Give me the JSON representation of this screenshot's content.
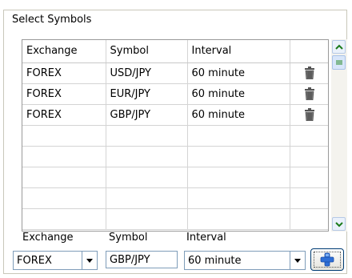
{
  "group": {
    "title": "Select Symbols"
  },
  "grid": {
    "columns": [
      "Exchange",
      "Symbol",
      "Interval",
      ""
    ],
    "rows": [
      {
        "exchange": "FOREX",
        "symbol": "USD/JPY",
        "interval": "60 minute",
        "action_icon": "trash-icon"
      },
      {
        "exchange": "FOREX",
        "symbol": "EUR/JPY",
        "interval": "60 minute",
        "action_icon": "trash-icon"
      },
      {
        "exchange": "FOREX",
        "symbol": "GBP/JPY",
        "interval": "60 minute",
        "action_icon": "trash-icon"
      }
    ]
  },
  "form": {
    "exchange_label": "Exchange",
    "symbol_label": "Symbol",
    "interval_label": "Interval",
    "exchange_value": "FOREX",
    "symbol_value": "GBP/JPY",
    "interval_value": "60 minute",
    "add_icon": "plus-icon"
  },
  "colors": {
    "accent": "#2b8c2b",
    "scroll_arrow": "#1a7a1a",
    "add_plus": "#2f6fd6"
  }
}
